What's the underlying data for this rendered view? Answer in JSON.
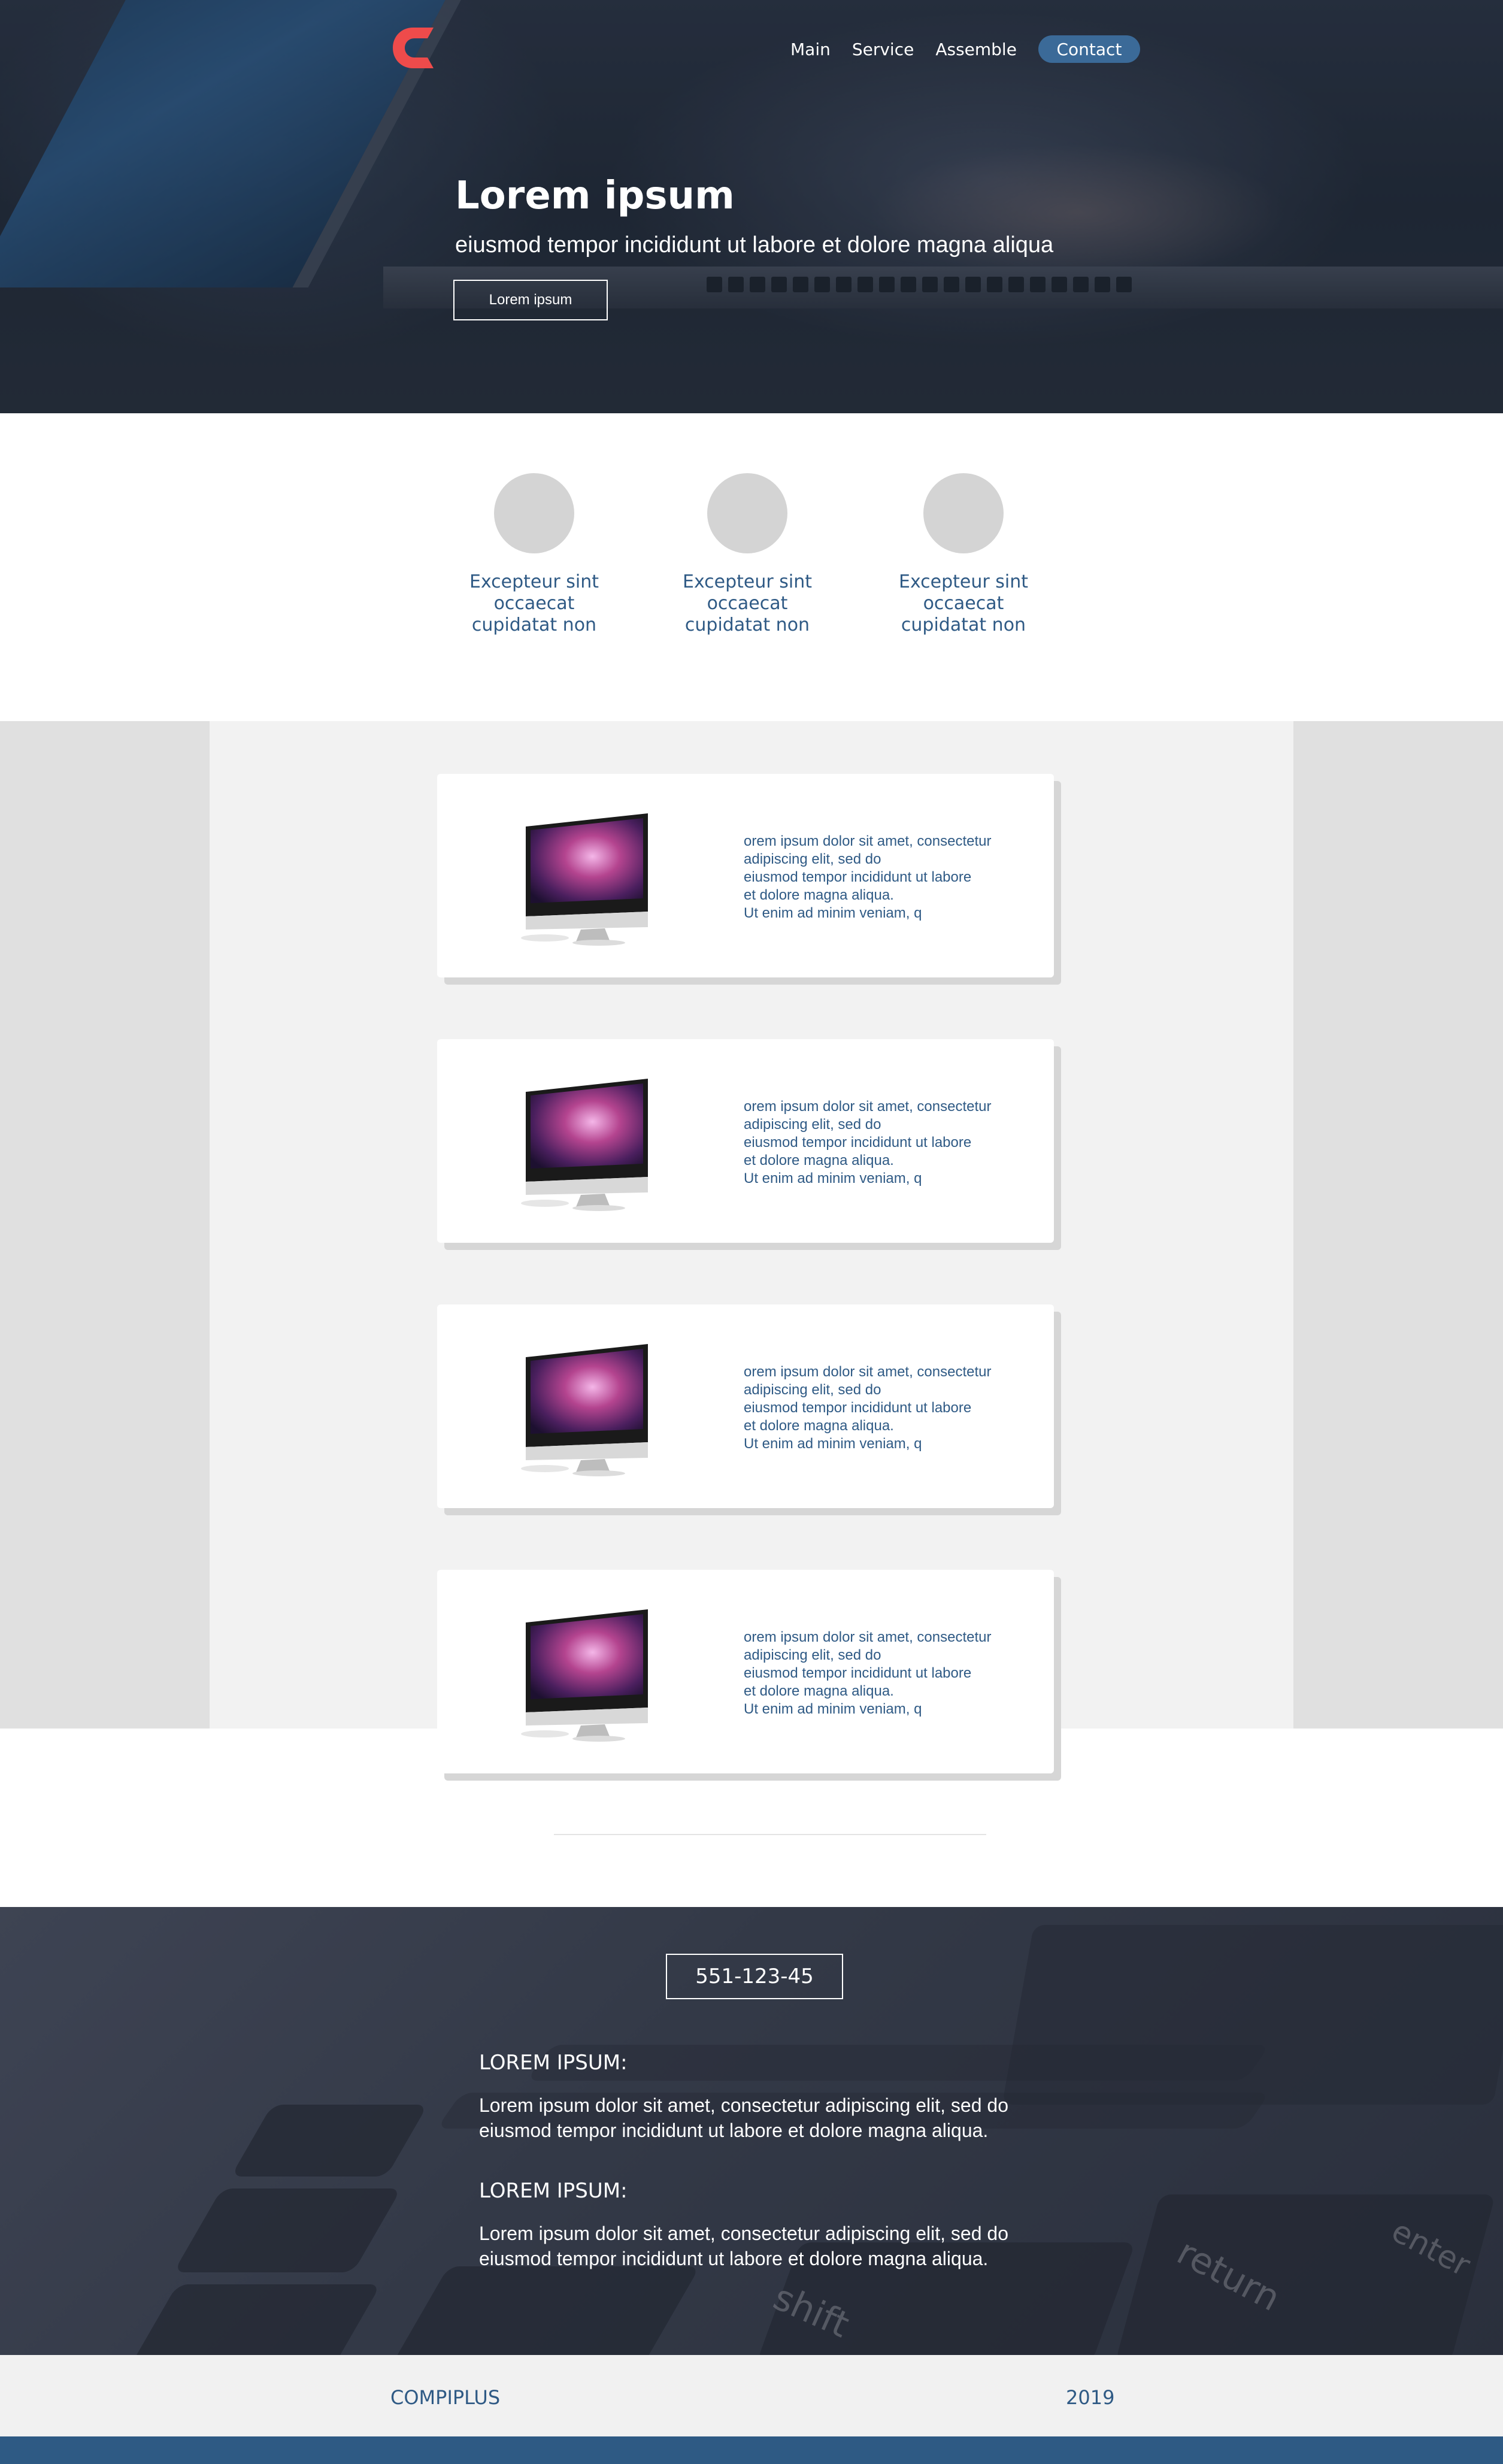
{
  "colors": {
    "accent": "#3b6a98",
    "text_blue": "#2f5a85",
    "logo_red": "#ee4b4b",
    "footer_bar": "#2e5a84"
  },
  "header": {
    "logo_icon": "logo-c-icon",
    "nav": [
      "Main",
      "Service",
      "Assemble"
    ],
    "contact_label": "Contact"
  },
  "hero": {
    "title": "Lorem ipsum",
    "subtitle": "eiusmod tempor incididunt ut labore et dolore magna aliqua",
    "button_label": "Lorem ipsum"
  },
  "features": [
    {
      "text": "Excepteur sint occaecat cupidatat non"
    },
    {
      "text": "Excepteur sint occaecat cupidatat non"
    },
    {
      "text": "Excepteur sint occaecat cupidatat non"
    }
  ],
  "products": [
    {
      "image": "imac-image",
      "text": "orem ipsum dolor sit amet, consectetur\nadipiscing elit, sed do\n eiusmod tempor incididunt ut labore\net dolore magna aliqua.\nUt enim ad minim veniam, q"
    },
    {
      "image": "imac-image",
      "text": "orem ipsum dolor sit amet, consectetur\nadipiscing elit, sed do\n eiusmod tempor incididunt ut labore\net dolore magna aliqua.\nUt enim ad minim veniam, q"
    },
    {
      "image": "imac-image",
      "text": "orem ipsum dolor sit amet, consectetur\nadipiscing elit, sed do\n eiusmod tempor incididunt ut labore\net dolore magna aliqua.\nUt enim ad minim veniam, q"
    },
    {
      "image": "imac-image",
      "text": "orem ipsum dolor sit amet, consectetur\nadipiscing elit, sed do\n eiusmod tempor incididunt ut labore\net dolore magna aliqua.\nUt enim ad minim veniam, q"
    }
  ],
  "contact": {
    "phone": "551-123-45",
    "blocks": [
      {
        "title": "LOREM IPSUM:",
        "text": "Lorem ipsum dolor sit amet, consectetur adipiscing elit, sed do\n eiusmod tempor incididunt ut labore et dolore magna aliqua."
      },
      {
        "title": "LOREM IPSUM:",
        "text": "Lorem ipsum dolor sit amet, consectetur adipiscing elit, sed do\n eiusmod tempor incididunt ut labore et dolore magna aliqua."
      }
    ],
    "keyboard_labels": [
      "shift",
      "return",
      "enter"
    ]
  },
  "footer": {
    "brand": "COMPIPLUS",
    "year": "2019"
  }
}
